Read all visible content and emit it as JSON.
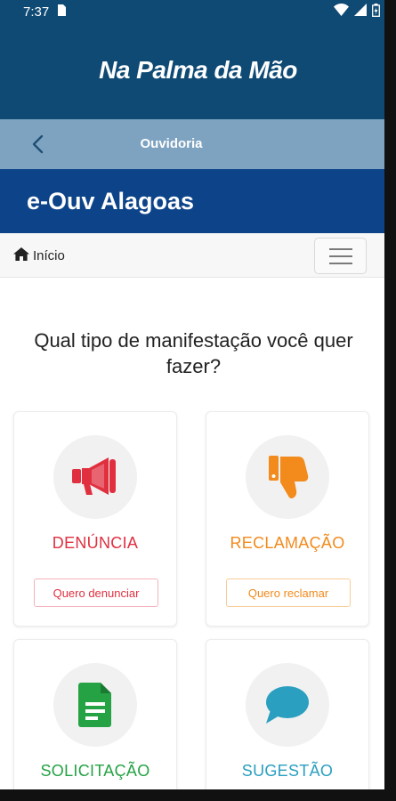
{
  "status_bar": {
    "time": "7:37",
    "icons": [
      "sim-card-icon",
      "wifi-icon",
      "signal-icon",
      "battery-icon"
    ]
  },
  "app_bar": {
    "title": "Na Palma da Mão"
  },
  "sub_bar": {
    "back_icon": "chevron-left-icon",
    "title": "Ouvidoria"
  },
  "header": {
    "title": "e-Ouv Alagoas"
  },
  "nav": {
    "home_label": "Início",
    "home_icon": "home-icon",
    "menu_icon": "hamburger-menu-icon"
  },
  "main": {
    "question": "Qual tipo de manifestação você quer fazer?",
    "cards": [
      {
        "label": "DENÚNCIA",
        "action": "Quero denunciar",
        "icon": "megaphone-icon",
        "color": "#e03040"
      },
      {
        "label": "RECLAMAÇÃO",
        "action": "Quero reclamar",
        "icon": "thumbs-down-icon",
        "color": "#f28a1c"
      },
      {
        "label": "SOLICITAÇÃO",
        "action": "",
        "icon": "document-icon",
        "color": "#25a244"
      },
      {
        "label": "SUGESTÃO",
        "action": "",
        "icon": "speech-bubble-icon",
        "color": "#2a9fc0"
      }
    ]
  },
  "colors": {
    "app_bar": "#0f4a74",
    "sub_bar": "#7ea3c0",
    "header": "#0d4489"
  }
}
